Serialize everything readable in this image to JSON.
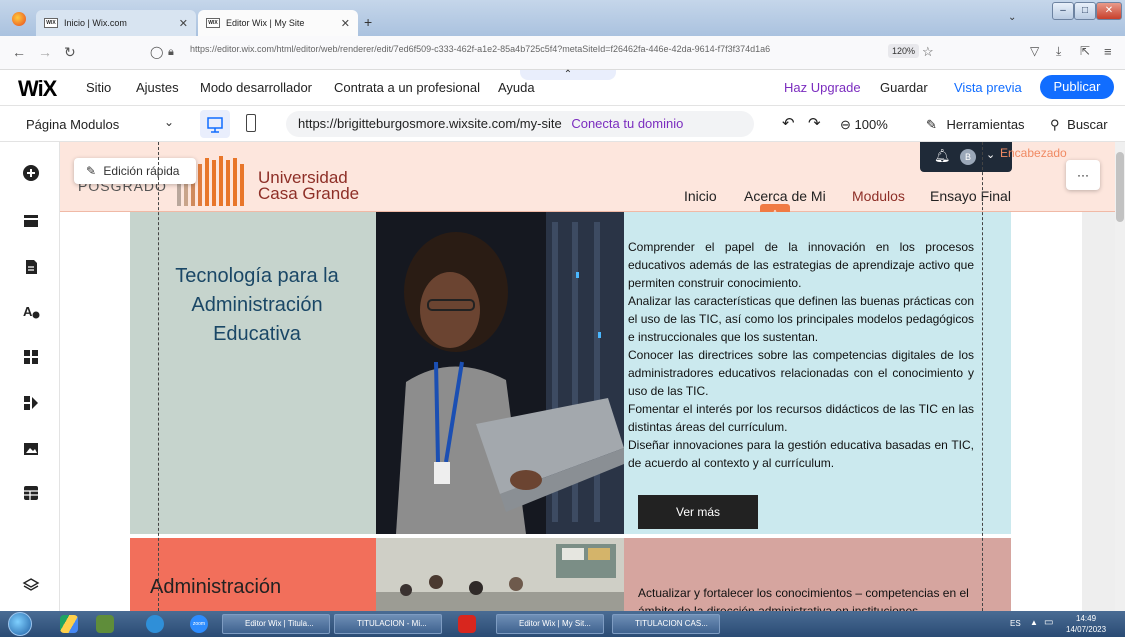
{
  "browser": {
    "tabs": [
      {
        "label": "Inicio | Wix.com",
        "favicon": "WIX"
      },
      {
        "label": "Editor Wix | My Site",
        "favicon": "WIX"
      }
    ],
    "url": "https://editor.wix.com/html/editor/web/renderer/edit/7ed6f509-c333-462f-a1e2-85a4b725c5f4?metaSiteId=f26462fa-446e-42da-9614-f7f3f374d1a6",
    "zoom": "120%"
  },
  "wix_top": {
    "logo": "WiX",
    "menu": [
      "Sitio",
      "Ajustes",
      "Modo desarrollador",
      "Contrata a un profesional",
      "Ayuda"
    ],
    "upgrade": "Haz Upgrade",
    "save": "Guardar",
    "preview": "Vista previa",
    "publish": "Publicar"
  },
  "wix_bar2": {
    "page": "Página Modulos",
    "site_url": "https://brigitteburgosmore.wixsite.com/my-site",
    "connect_domain": "Conecta tu dominio",
    "zoom": "100%",
    "tools": "Herramientas",
    "search": "Buscar"
  },
  "header": {
    "quick_edit": "Edición rápida",
    "posgrado": "POSGRADO",
    "uni_line1": "Universidad",
    "uni_line2": "Casa Grande",
    "nav": [
      "Inicio",
      "Acerca de Mi",
      "Modulos",
      "Ensayo Final"
    ],
    "badge": "B",
    "section_label": "Encabezado"
  },
  "row1": {
    "title": "Tecnología para la Administración Educativa",
    "paragraphs": [
      "Comprender el papel de la innovación en los procesos educativos además de las estrategias de aprendizaje activo que permiten construir conocimiento.",
      "Analizar las características que definen las buenas prácticas con el uso de las TIC, así como los principales modelos pedagógicos e instruccionales que los sustentan.",
      "Conocer las directrices sobre las competencias digitales de los administradores educativos relacionadas con el conocimiento y uso de las TIC.",
      "Fomentar el interés por los recursos didácticos de las TIC en las distintas áreas del currículum.",
      "Diseñar innovaciones para la gestión educativa basadas en TIC, de acuerdo al contexto y al currículum."
    ],
    "button": "Ver más"
  },
  "row2": {
    "title": "Administración",
    "text": "Actualizar y fortalecer los conocimientos – competencias en el ámbito de la dirección administrativa en instituciones"
  },
  "taskbar": {
    "items": [
      "zoom",
      "Editor Wix | Titula...",
      "TITULACION - Mi...",
      "Editor Wix | My Sit...",
      "TITULACION CAS..."
    ],
    "lang": "ES",
    "time": "14:49",
    "date": "14/07/2023"
  }
}
